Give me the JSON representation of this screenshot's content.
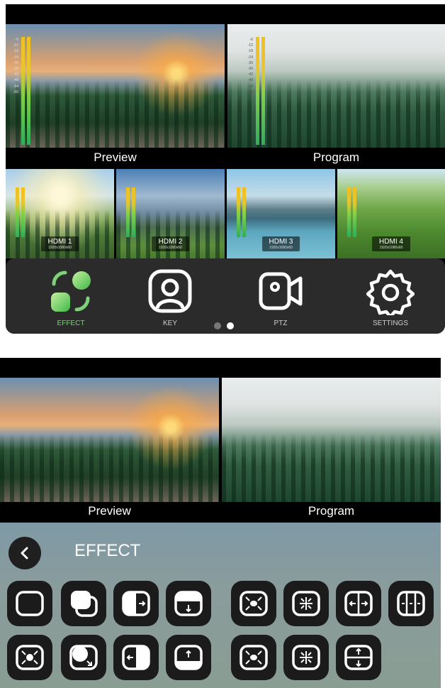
{
  "top": {
    "preview_label": "Preview",
    "program_label": "Program",
    "vu_scale": [
      "-6",
      "-12",
      "-18",
      "-24",
      "-30",
      "-36",
      "-42",
      "-48",
      "-54",
      "-60"
    ],
    "inputs": [
      {
        "name": "HDMI 1",
        "resolution": "1920x1080x60"
      },
      {
        "name": "HDMI 2",
        "resolution": "1920x1080x60"
      },
      {
        "name": "HDMI 3",
        "resolution": "1920x1080x60"
      },
      {
        "name": "HDMI 4",
        "resolution": "1920x1080x60"
      }
    ],
    "functions": [
      {
        "label": "EFFECT",
        "icon": "effect-icon",
        "active": true
      },
      {
        "label": "KEY",
        "icon": "key-icon",
        "active": false
      },
      {
        "label": "PTZ",
        "icon": "ptz-camera-icon",
        "active": false
      },
      {
        "label": "SETTINGS",
        "icon": "gear-icon",
        "active": false
      }
    ],
    "pager": {
      "pages": 2,
      "current": 2
    },
    "colors": {
      "accent": "#7fd07a",
      "bar": "#2b2b2b"
    }
  },
  "bottom": {
    "preview_label": "Preview",
    "program_label": "Program",
    "effect_title": "EFFECT",
    "back_icon": "chevron-left-icon",
    "effects_row1": [
      "cut-icon",
      "fade-icon",
      "wipe-right-icon",
      "wipe-down-icon",
      "zoom-in-icon",
      "zoom-out-icon",
      "split-horizontal-icon",
      "split-quad-icon"
    ],
    "effects_row2": [
      "iris-icon",
      "circle-wipe-icon",
      "wipe-left-icon",
      "wipe-up-icon",
      "zoom-in-alt-icon",
      "zoom-out-alt-icon",
      "split-vertical-icon"
    ]
  }
}
